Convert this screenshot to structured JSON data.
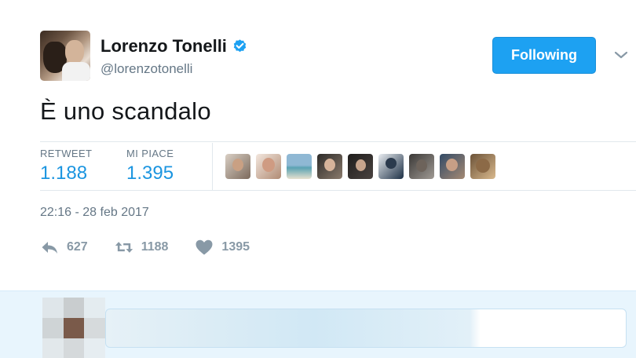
{
  "tweet": {
    "author": {
      "display_name": "Lorenzo Tonelli",
      "handle": "@lorenzotonelli",
      "verified": true,
      "avatar_icon": "user-avatar"
    },
    "follow_button": {
      "label": "Following",
      "color": "#1da1f2"
    },
    "menu_icon": "chevron-down-icon",
    "text": "È uno scandalo",
    "stats": {
      "retweets": {
        "label": "RETWEET",
        "value": "1.188"
      },
      "likes": {
        "label": "MI PIACE",
        "value": "1.395"
      }
    },
    "likers_count_shown": 9,
    "timestamp": "22:16 - 28 feb 2017",
    "actions": {
      "reply": {
        "icon": "reply-icon",
        "count": "627"
      },
      "retweet": {
        "icon": "retweet-icon",
        "count": "1188"
      },
      "like": {
        "icon": "heart-icon",
        "count": "1395"
      }
    }
  },
  "reply_bar": {
    "input_value": ""
  },
  "colors": {
    "accent": "#1da1f2",
    "link": "#1b95e0",
    "muted": "#657786",
    "action_gray": "#8899a6",
    "reply_bg": "#e8f5fd"
  }
}
